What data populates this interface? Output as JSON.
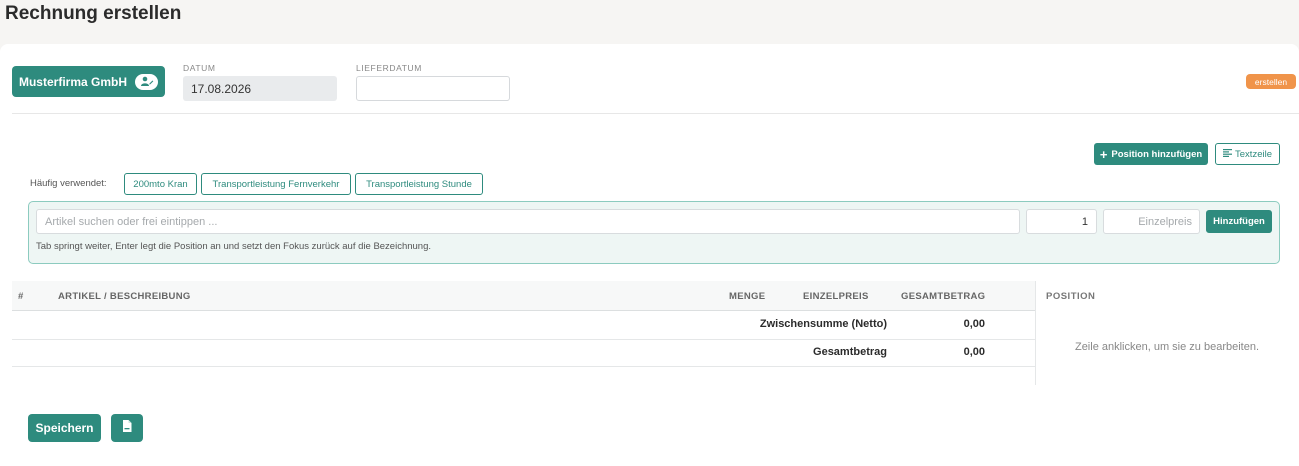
{
  "page": {
    "title": "Rechnung erstellen"
  },
  "header": {
    "customer_label": "Musterfirma GmbH",
    "datum_label": "DATUM",
    "datum_value": "17.08.2026",
    "lieferdatum_label": "LIEFERDATUM",
    "lieferdatum_value": "",
    "status": "erstellen"
  },
  "toolbar": {
    "add_position": "Position hinzufügen",
    "textzeile": "Textzeile"
  },
  "favorites": {
    "label": "Häufig verwendet:",
    "items": [
      "200mto Kran",
      "Transportleistung Fernverkehr",
      "Transportleistung Stunde"
    ]
  },
  "entry": {
    "article_placeholder": "Artikel suchen oder frei eintippen ...",
    "quantity": "1",
    "price_placeholder": "Einzelpreis",
    "add_button": "Hinzufügen",
    "hint": "Tab springt weiter, Enter legt die Position an und setzt den Fokus zurück auf die Bezeichnung."
  },
  "table": {
    "columns": [
      "#",
      "ARTIKEL / BESCHREIBUNG",
      "MENGE",
      "EINZELPREIS",
      "GESAMTBETRAG"
    ],
    "subtotal_label": "Zwischensumme (Netto)",
    "subtotal_value": "0,00",
    "total_label": "Gesamtbetrag",
    "total_value": "0,00"
  },
  "side_panel": {
    "title": "POSITION",
    "hint": "Zeile anklicken, um sie zu bearbeiten."
  },
  "footer": {
    "save_label": "Speichern"
  },
  "colors": {
    "accent": "#2e8b7e",
    "status": "#f0944a"
  }
}
